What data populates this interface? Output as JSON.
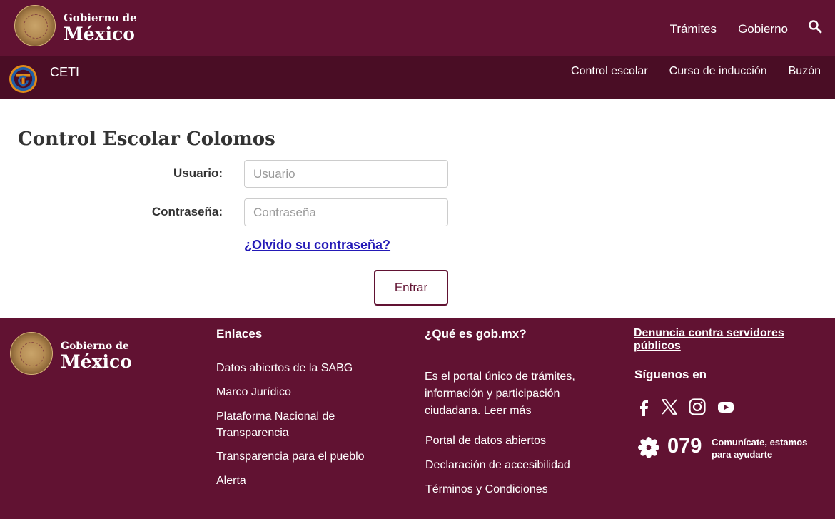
{
  "header": {
    "brand_small": "Gobierno de",
    "brand_big": "México",
    "nav": [
      "Trámites",
      "Gobierno"
    ],
    "search_icon": "search-icon"
  },
  "subheader": {
    "name": "CETI",
    "nav": [
      "Control escolar",
      "Curso de inducción",
      "Buzón"
    ]
  },
  "login": {
    "title": "Control Escolar Colomos",
    "user_label": "Usuario:",
    "user_placeholder": "Usuario",
    "user_value": "",
    "pass_label": "Contraseña:",
    "pass_placeholder": "Contraseña",
    "pass_value": "",
    "forgot": "¿Olvido su contraseña?",
    "submit": "Entrar"
  },
  "footer": {
    "brand_small": "Gobierno de",
    "brand_big": "México",
    "enlaces": {
      "heading": "Enlaces",
      "items": [
        "Datos abiertos de la SABG",
        "Marco Jurídico",
        "Plataforma Nacional de Transparencia",
        "Transparencia para el pueblo",
        "Alerta"
      ]
    },
    "about": {
      "heading": "¿Qué es gob.mx?",
      "text": "Es el portal único de trámites, información y participación ciudadana.",
      "more": "Leer más",
      "links": [
        "Portal de datos abiertos",
        "Declaración de accesibilidad",
        "Términos y Condiciones"
      ]
    },
    "denuncia": "Denuncia contra servidores públicos",
    "follow": "Síguenos en",
    "social_icons": [
      "facebook-icon",
      "x-icon",
      "instagram-icon",
      "youtube-icon"
    ],
    "phone": "079",
    "phone_text": "Comunícate, estamos para ayudarte"
  },
  "colors": {
    "primary": "#611232",
    "secondary": "#4a0d25",
    "accent": "#a57f2c"
  }
}
